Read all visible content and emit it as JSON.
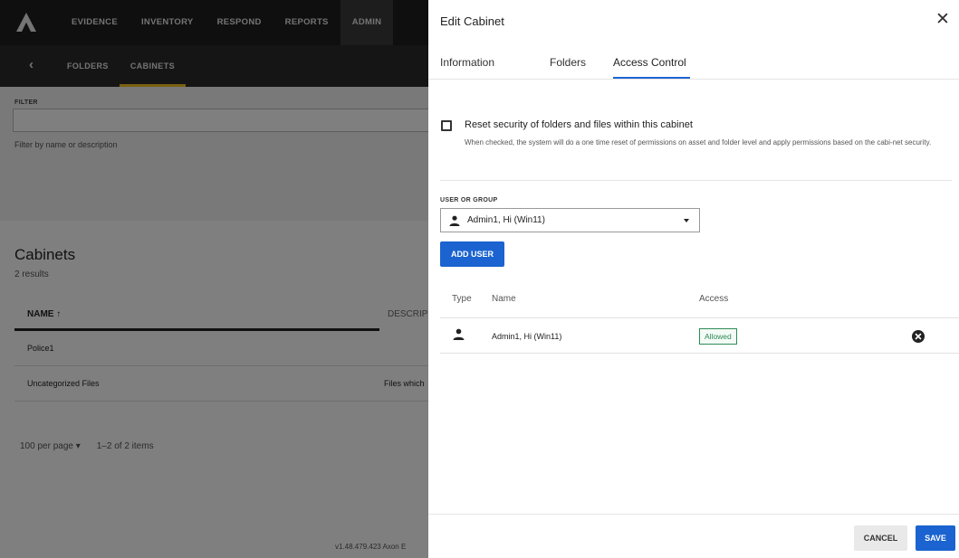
{
  "nav": {
    "items": [
      {
        "label": "EVIDENCE",
        "active": false
      },
      {
        "label": "INVENTORY",
        "active": false
      },
      {
        "label": "RESPOND",
        "active": false
      },
      {
        "label": "REPORTS",
        "active": false
      },
      {
        "label": "ADMIN",
        "active": true
      }
    ]
  },
  "subnav": {
    "back_glyph": "‹",
    "items": [
      {
        "label": "FOLDERS",
        "active": false
      },
      {
        "label": "CABINETS",
        "active": true
      }
    ]
  },
  "filter": {
    "label": "FILTER",
    "help": "Filter by name or description"
  },
  "cabinets": {
    "title": "Cabinets",
    "count": "2 results",
    "columns": {
      "name": "NAME ↑",
      "description": "DESCRIP"
    },
    "rows": [
      {
        "name": "Police1",
        "description": ""
      },
      {
        "name": "Uncategorized Files",
        "description": "Files which"
      }
    ],
    "pager": {
      "per_page": "100 per page ▾",
      "range": "1–2 of 2 items"
    },
    "version": "v1.48.479.423 Axon E"
  },
  "panel": {
    "title": "Edit Cabinet",
    "close_glyph": "✕",
    "tabs": [
      {
        "label": "Information",
        "active": false
      },
      {
        "label": "Folders",
        "active": false
      },
      {
        "label": "Access Control",
        "active": true
      }
    ],
    "reset": {
      "label": "Reset security of folders and files within this cabinet",
      "help": "When checked, the system will do a one time reset of permissions on asset and folder level and apply permissions based on the cabi-net security.",
      "checked": false
    },
    "user_group": {
      "label": "USER OR GROUP",
      "selected": "Admin1, Hi (Win11)"
    },
    "add_user_label": "ADD USER",
    "access_table": {
      "headers": {
        "type": "Type",
        "name": "Name",
        "access": "Access"
      },
      "rows": [
        {
          "type_icon": "person-icon",
          "name": "Admin1, Hi (Win11)",
          "access": "Allowed"
        }
      ]
    },
    "cancel_label": "CANCEL",
    "save_label": "SAVE"
  },
  "colors": {
    "primary": "#1a63d0",
    "nav_bg": "#1f1f1f",
    "active_tab_indicator": "#f2c01e",
    "allowed_green": "#2e8b57"
  }
}
